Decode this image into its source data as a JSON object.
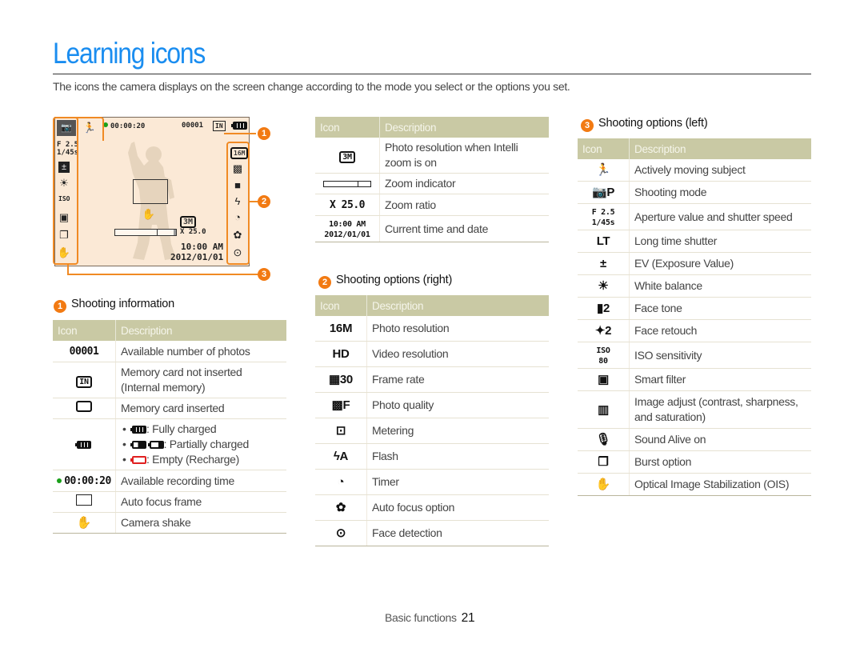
{
  "page": {
    "title": "Learning icons",
    "intro": "The icons the camera displays on the screen change according to the mode you select or the options you set."
  },
  "colors": {
    "title": "#1a8df0",
    "accent_orange": "#f27a12",
    "table_header_bg": "#c9c9a4",
    "screen_bg": "#fbe9d6"
  },
  "screen": {
    "recording_time": "00:00:20",
    "photo_count": "00001",
    "memory_icon": "IN",
    "aperture": "F 2.5",
    "shutter": "1/45s",
    "zoom_ratio": "X 25.0",
    "time": "10:00 AM",
    "date": "2012/01/01",
    "resolution_intelli": "3M",
    "resolution": "16M",
    "callouts": [
      "1",
      "2",
      "3"
    ]
  },
  "sections": {
    "info": {
      "number": "1",
      "heading": "Shooting information",
      "header_icon": "Icon",
      "header_desc": "Description",
      "rows": [
        {
          "icon": "00001",
          "icon_name": "photo-count-icon",
          "desc": "Available number of photos"
        },
        {
          "icon": "IN",
          "icon_name": "internal-memory-icon",
          "desc": "Memory card not inserted (Internal memory)"
        },
        {
          "icon": "",
          "icon_name": "memory-card-icon",
          "desc": "Memory card inserted"
        },
        {
          "icon": "",
          "icon_name": "battery-icon",
          "desc": "",
          "bullets": [
            {
              "icon_name": "battery-full-icon",
              "text": ": Fully charged"
            },
            {
              "icon_name": "battery-partial-icon",
              "text": ": Partially charged"
            },
            {
              "icon_name": "battery-empty-icon",
              "text": ": Empty (Recharge)"
            }
          ]
        },
        {
          "icon": "00:00:20",
          "icon_name": "recording-time-icon",
          "desc": "Available recording time"
        },
        {
          "icon": "",
          "icon_name": "af-frame-icon",
          "desc": "Auto focus frame"
        },
        {
          "icon": "✋",
          "icon_name": "camera-shake-icon",
          "desc": "Camera shake"
        }
      ]
    },
    "center": {
      "header_icon": "Icon",
      "header_desc": "Description",
      "rows": [
        {
          "icon": "3M",
          "icon_name": "intelli-zoom-resolution-icon",
          "desc": "Photo resolution when Intelli zoom is on"
        },
        {
          "icon": "",
          "icon_name": "zoom-indicator-icon",
          "desc": "Zoom indicator"
        },
        {
          "icon": "X 25.0",
          "icon_name": "zoom-ratio-icon",
          "desc": "Zoom ratio"
        },
        {
          "icon": "10:00 AM",
          "icon2": "2012/01/01",
          "icon_name": "time-date-icon",
          "desc": "Current time and date"
        }
      ]
    },
    "right_opts": {
      "number": "2",
      "heading": "Shooting options (right)",
      "header_icon": "Icon",
      "header_desc": "Description",
      "rows": [
        {
          "icon": "16M",
          "icon_name": "photo-resolution-icon",
          "desc": "Photo resolution"
        },
        {
          "icon": "HD",
          "icon_name": "video-resolution-icon",
          "desc": "Video resolution"
        },
        {
          "icon": "▦30",
          "icon_name": "frame-rate-icon",
          "desc": "Frame rate"
        },
        {
          "icon": "▩F",
          "icon_name": "photo-quality-icon",
          "desc": "Photo quality"
        },
        {
          "icon": "⊡",
          "icon_name": "metering-icon",
          "desc": "Metering"
        },
        {
          "icon": "ϟA",
          "icon_name": "flash-icon",
          "desc": "Flash"
        },
        {
          "icon": "◔",
          "icon_name": "timer-icon",
          "desc": "Timer"
        },
        {
          "icon": "✿",
          "icon_name": "af-option-icon",
          "desc": "Auto focus option"
        },
        {
          "icon": "⊙",
          "icon_name": "face-detection-icon",
          "desc": "Face detection"
        }
      ]
    },
    "left_opts": {
      "number": "3",
      "heading": "Shooting options (left)",
      "header_icon": "Icon",
      "header_desc": "Description",
      "rows": [
        {
          "icon": "🏃",
          "icon_name": "moving-subject-icon",
          "desc": "Actively moving subject"
        },
        {
          "icon": "📷P",
          "icon_name": "shooting-mode-icon",
          "desc": "Shooting mode"
        },
        {
          "icon": "F 2.5",
          "icon2": "1/45s",
          "icon_name": "aperture-shutter-icon",
          "desc": "Aperture value and shutter speed"
        },
        {
          "icon": "LT",
          "icon_name": "long-time-shutter-icon",
          "desc": "Long time shutter"
        },
        {
          "icon": "±",
          "icon_name": "ev-icon",
          "desc": "EV (Exposure Value)"
        },
        {
          "icon": "☀",
          "icon_name": "white-balance-icon",
          "desc": "White balance"
        },
        {
          "icon": "▮2",
          "icon_name": "face-tone-icon",
          "desc": "Face tone"
        },
        {
          "icon": "✦2",
          "icon_name": "face-retouch-icon",
          "desc": "Face retouch"
        },
        {
          "icon": "ISO",
          "icon2": "80",
          "icon_name": "iso-icon",
          "desc": "ISO sensitivity"
        },
        {
          "icon": "▣",
          "icon_name": "smart-filter-icon",
          "desc": "Smart filter"
        },
        {
          "icon": "▥",
          "icon_name": "image-adjust-icon",
          "desc": "Image adjust (contrast, sharpness, and saturation)"
        },
        {
          "icon": "🎙",
          "icon_name": "sound-alive-icon",
          "desc": "Sound Alive on"
        },
        {
          "icon": "❐",
          "icon_name": "burst-icon",
          "desc": "Burst option"
        },
        {
          "icon": "✋",
          "icon_name": "ois-icon",
          "desc": "Optical Image Stabilization (OIS)"
        }
      ]
    }
  },
  "footer": {
    "section": "Basic functions",
    "page_number": "21"
  }
}
